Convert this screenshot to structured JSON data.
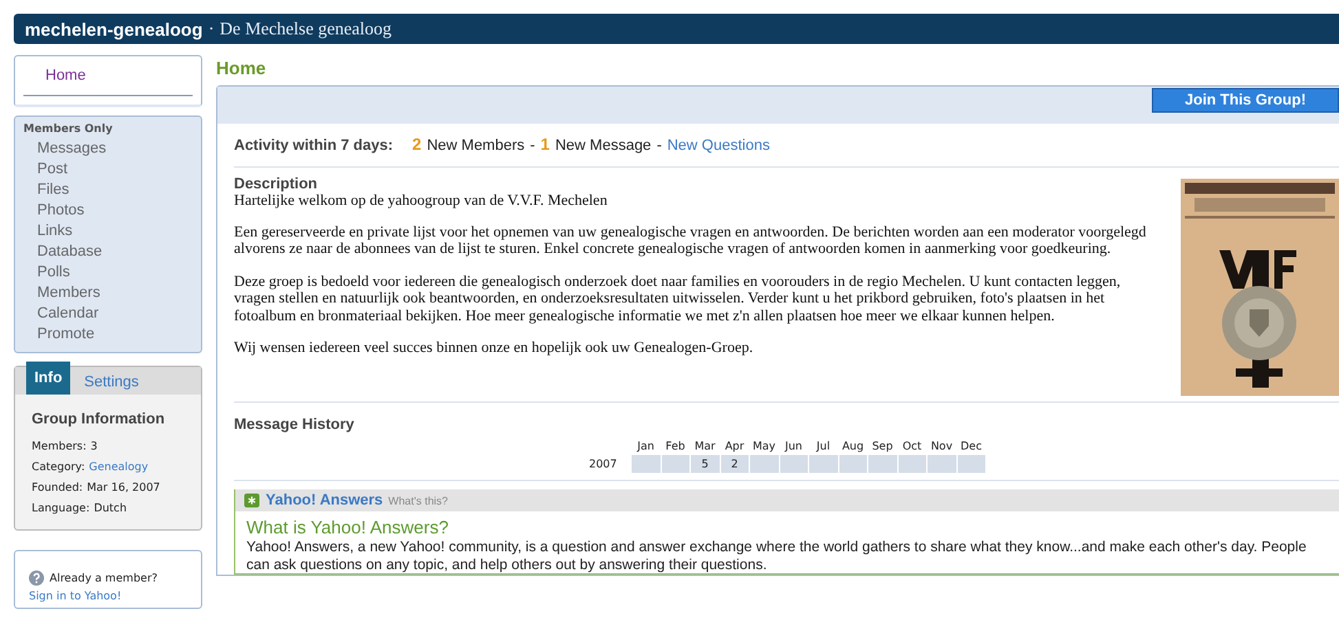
{
  "header": {
    "group": "mechelen-genealoog",
    "separator": "·",
    "tagline": "De Mechelse genealoog"
  },
  "sidebar": {
    "home": {
      "label": "Home",
      "selected": true
    },
    "section": "Members Only",
    "items": [
      {
        "label": "Messages"
      },
      {
        "label": "Post"
      },
      {
        "label": "Files"
      },
      {
        "label": "Photos"
      },
      {
        "label": "Links"
      },
      {
        "label": "Database"
      },
      {
        "label": "Polls"
      },
      {
        "label": "Members"
      },
      {
        "label": "Calendar"
      },
      {
        "label": "Promote"
      }
    ],
    "info_tabs": [
      {
        "label": "Info",
        "selected": true
      },
      {
        "label": "Settings",
        "selected": false
      }
    ],
    "info_title": "Group Information",
    "info": [
      {
        "label": "Members:",
        "value": "3",
        "kind": "text"
      },
      {
        "label": "Category:",
        "value": "Genealogy",
        "kind": "link"
      },
      {
        "label": "Founded:",
        "value": "Mar 16, 2007",
        "kind": "text"
      },
      {
        "label": "Language:",
        "value": "Dutch",
        "kind": "text"
      }
    ],
    "member_prompt": "Already a member?",
    "sign_in": "Sign in to Yahoo!"
  },
  "page_title": "Home",
  "join_button": "Join This Group!",
  "activity": {
    "label": "Activity within 7 days:",
    "members_count": "2",
    "members_text": "New Members",
    "sep1": "-",
    "messages_count": "1",
    "messages_text": "New Message",
    "sep2": "-",
    "questions_link": "New Questions"
  },
  "description": {
    "heading": "Description",
    "paragraphs": [
      "Hartelijke welkom op de yahoogroup van de V.V.F. Mechelen",
      "Een gereserveerde en private lijst voor het opnemen van uw genealogische vragen en antwoorden. De berichten worden aan een moderator voorgelegd alvorens ze naar de abonnees van de lijst te sturen. Enkel concrete genealogische vragen of antwoorden komen in aanmerking voor goedkeuring.",
      "Deze groep is bedoeld voor iedereen die genealogisch onderzoek doet naar families en voorouders in de regio Mechelen. U kunt contacten leggen, vragen stellen en natuurlijk ook beantwoorden, en onderzoeksresultaten uitwisselen. Verder kunt u het prikbord gebruiken, foto's plaatsen in het fotoalbum en bronmateriaal bekijken. Hoe meer genealogische informatie we met z'n allen plaatsen hoe meer we elkaar kunnen helpen.",
      "Wij wensen iedereen veel succes binnen onze en hopelijk ook uw Genealogen-Groep."
    ]
  },
  "message_history": {
    "heading": "Message History",
    "year": "2007",
    "months": [
      {
        "name": "Jan"
      },
      {
        "name": "Feb"
      },
      {
        "name": "Mar",
        "count": "5"
      },
      {
        "name": "Apr",
        "count": "2"
      },
      {
        "name": "May"
      },
      {
        "name": "Jun"
      },
      {
        "name": "Jul"
      },
      {
        "name": "Aug"
      },
      {
        "name": "Sep"
      },
      {
        "name": "Oct"
      },
      {
        "name": "Nov"
      },
      {
        "name": "Dec"
      }
    ]
  },
  "answers": {
    "brand": "Yahoo! Answers",
    "whats_this": "What's this?",
    "title": "What is Yahoo! Answers?",
    "text": "Yahoo! Answers, a new Yahoo! community, is a question and answer exchange where the world gathers to share what they know...and make each other's day. People can ask questions on any topic, and help others out by answering their questions."
  }
}
